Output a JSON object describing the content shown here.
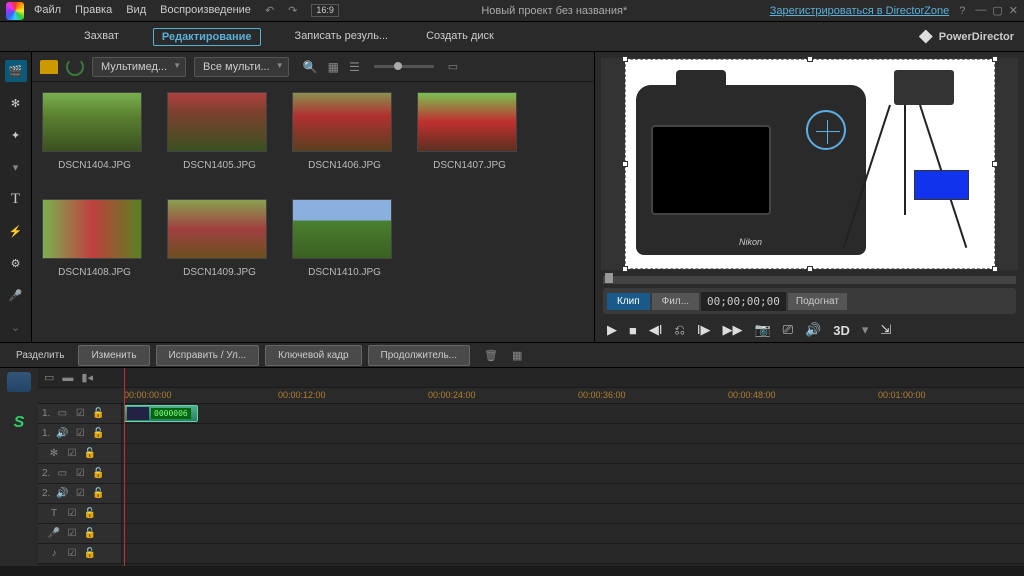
{
  "menus": {
    "file": "Файл",
    "edit": "Правка",
    "view": "Вид",
    "play": "Воспроизведение"
  },
  "title": "Новый проект без названия*",
  "dz_link": "Зарегистрироваться в DirectorZone",
  "brand": "PowerDirector",
  "tabs": {
    "capture": "Захват",
    "edit": "Редактирование",
    "produce": "Записать резуль...",
    "disc": "Создать диск"
  },
  "aspect": "16:9",
  "library": {
    "dd1": "Мультимед...",
    "dd2": "Все мульти...",
    "items": [
      {
        "name": "DSCN1404.JPG"
      },
      {
        "name": "DSCN1405.JPG"
      },
      {
        "name": "DSCN1406.JPG"
      },
      {
        "name": "DSCN1407.JPG"
      },
      {
        "name": "DSCN1408.JPG"
      },
      {
        "name": "DSCN1409.JPG"
      },
      {
        "name": "DSCN1410.JPG"
      }
    ]
  },
  "preview": {
    "tab_clip": "Клип",
    "tab_movie": "Фил...",
    "timecode": "00;00;00;00",
    "fit": "Подогнат",
    "nikon": "Nikon",
    "t3d": "3D"
  },
  "editbar": {
    "split": "Разделить",
    "modify": "Изменить",
    "fix": "Исправить / Ул...",
    "keyframe": "Ключевой кадр",
    "duration": "Продолжитель..."
  },
  "timeline": {
    "times": [
      "00:00:00:00",
      "00:00:12:00",
      "00:00:24:00",
      "00:00:36:00",
      "00:00:48:00",
      "00:01:00:00"
    ],
    "clip_time": "0000006",
    "tracks": [
      {
        "n": "1.",
        "icon": "▭"
      },
      {
        "n": "1.",
        "icon": "🔊"
      },
      {
        "n": "",
        "icon": "✻"
      },
      {
        "n": "2.",
        "icon": "▭"
      },
      {
        "n": "2.",
        "icon": "🔊"
      },
      {
        "n": "",
        "icon": "T"
      },
      {
        "n": "",
        "icon": "🎤"
      },
      {
        "n": "",
        "icon": "♪"
      }
    ]
  }
}
